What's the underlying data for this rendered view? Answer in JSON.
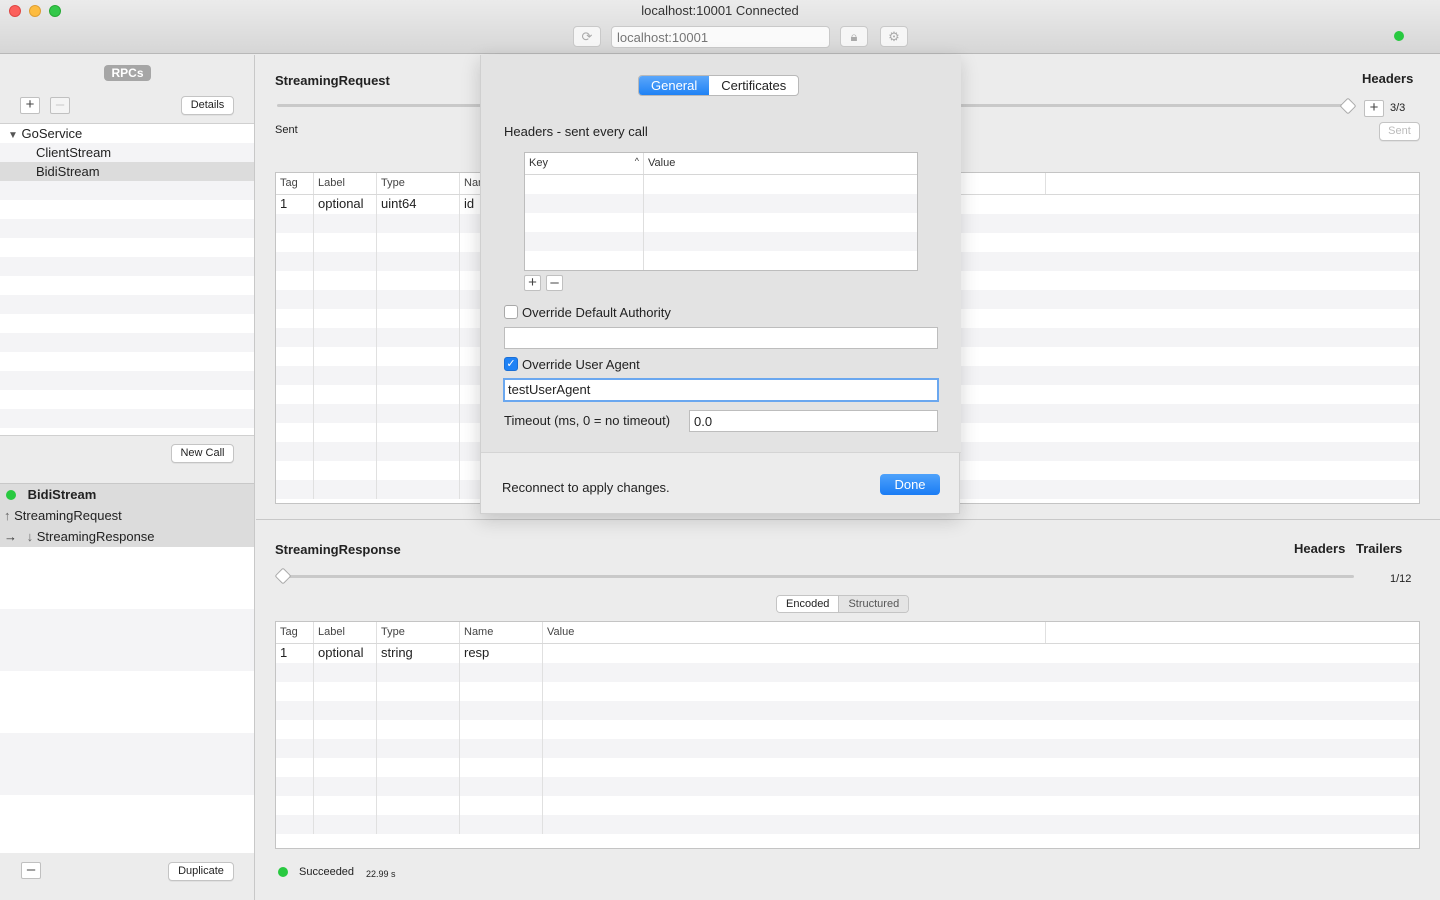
{
  "window": {
    "title": "localhost:10001 Connected",
    "url_placeholder": "localhost:10001",
    "status_color": "#28c940"
  },
  "sidebar": {
    "rpcs_label": "RPCs",
    "details_label": "Details",
    "service": "GoService",
    "methods": [
      "ClientStream",
      "BidiStream"
    ],
    "new_call_label": "New Call",
    "duplicate_label": "Duplicate",
    "calls": {
      "active_call": "BidiStream",
      "request": "StreamingRequest",
      "response": "StreamingResponse"
    }
  },
  "request": {
    "title": "StreamingRequest",
    "headers_label": "Headers",
    "counter": "3/3",
    "sent_label": "Sent",
    "sent_button": "Sent",
    "columns": [
      "Tag",
      "Label",
      "Type",
      "Nar"
    ],
    "rows": [
      {
        "tag": "1",
        "label": "optional",
        "type": "uint64",
        "name": "id"
      }
    ]
  },
  "response": {
    "title": "StreamingResponse",
    "headers_label": "Headers",
    "trailers_label": "Trailers",
    "counter": "1/12",
    "seg_encoded": "Encoded",
    "seg_structured": "Structured",
    "columns": [
      "Tag",
      "Label",
      "Type",
      "Name",
      "Value"
    ],
    "rows": [
      {
        "tag": "1",
        "label": "optional",
        "type": "string",
        "name": "resp",
        "value": ""
      }
    ],
    "status": "Succeeded",
    "duration": "22.99 s"
  },
  "sheet": {
    "tab_general": "General",
    "tab_certificates": "Certificates",
    "headers_caption": "Headers - sent every call",
    "key_col": "Key",
    "value_col": "Value",
    "override_authority_label": "Override Default Authority",
    "override_authority_checked": false,
    "authority_value": "",
    "override_agent_label": "Override User Agent",
    "override_agent_checked": true,
    "agent_value": "testUserAgent",
    "timeout_label": "Timeout (ms, 0 = no timeout)",
    "timeout_value": "0.0",
    "reconnect_note": "Reconnect to apply changes.",
    "done_label": "Done"
  }
}
